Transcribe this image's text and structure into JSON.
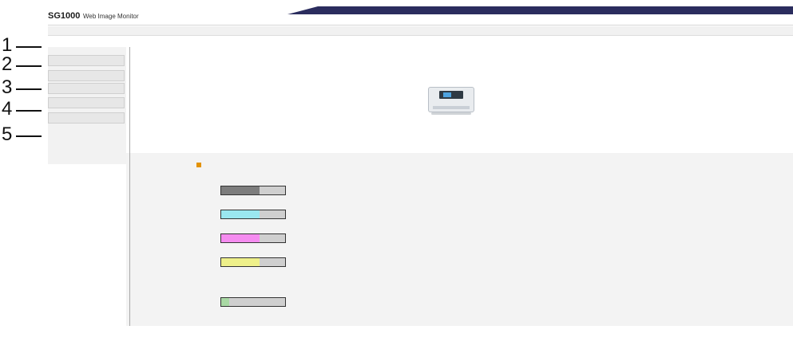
{
  "callouts": [
    "1",
    "2",
    "3",
    "4",
    "5"
  ],
  "header": {
    "model": "SG1000",
    "model_sub": "Web Image Monitor",
    "right_line1": "",
    "right_line2": ""
  },
  "subbar": {
    "crumb": ""
  },
  "toolbar": {
    "refresh": "",
    "help": "",
    "language": ""
  },
  "sidebar": {
    "items": [
      "",
      "",
      "",
      "",
      ""
    ]
  },
  "device_info": {
    "left_labels": [
      "",
      ""
    ],
    "serial_value": "",
    "right_labels": [
      "",
      ""
    ],
    "right_value": ""
  },
  "status": {
    "section_title": "",
    "status_label": "",
    "status_value": "",
    "ink_section": "",
    "remaining_section": "",
    "maintenance": ""
  },
  "ink": [
    {
      "name": "",
      "level_num": "",
      "level": 0.6,
      "color": "#7d7d7d"
    },
    {
      "name": "",
      "level_num": "",
      "level": 0.6,
      "color": "#9ae7f0"
    },
    {
      "name": "",
      "level_num": "",
      "level": 0.6,
      "color": "#f58cf0"
    },
    {
      "name": "",
      "level_num": "",
      "level": 0.6,
      "color": "#eef08a"
    }
  ],
  "maint_box": {
    "name": "",
    "level_num": "",
    "level": 0.12,
    "color": "#a9d9a4"
  },
  "right_panel": {
    "label1": "",
    "value1": "",
    "label2": "",
    "value2": "",
    "side_value1": "",
    "side_value2": ""
  }
}
